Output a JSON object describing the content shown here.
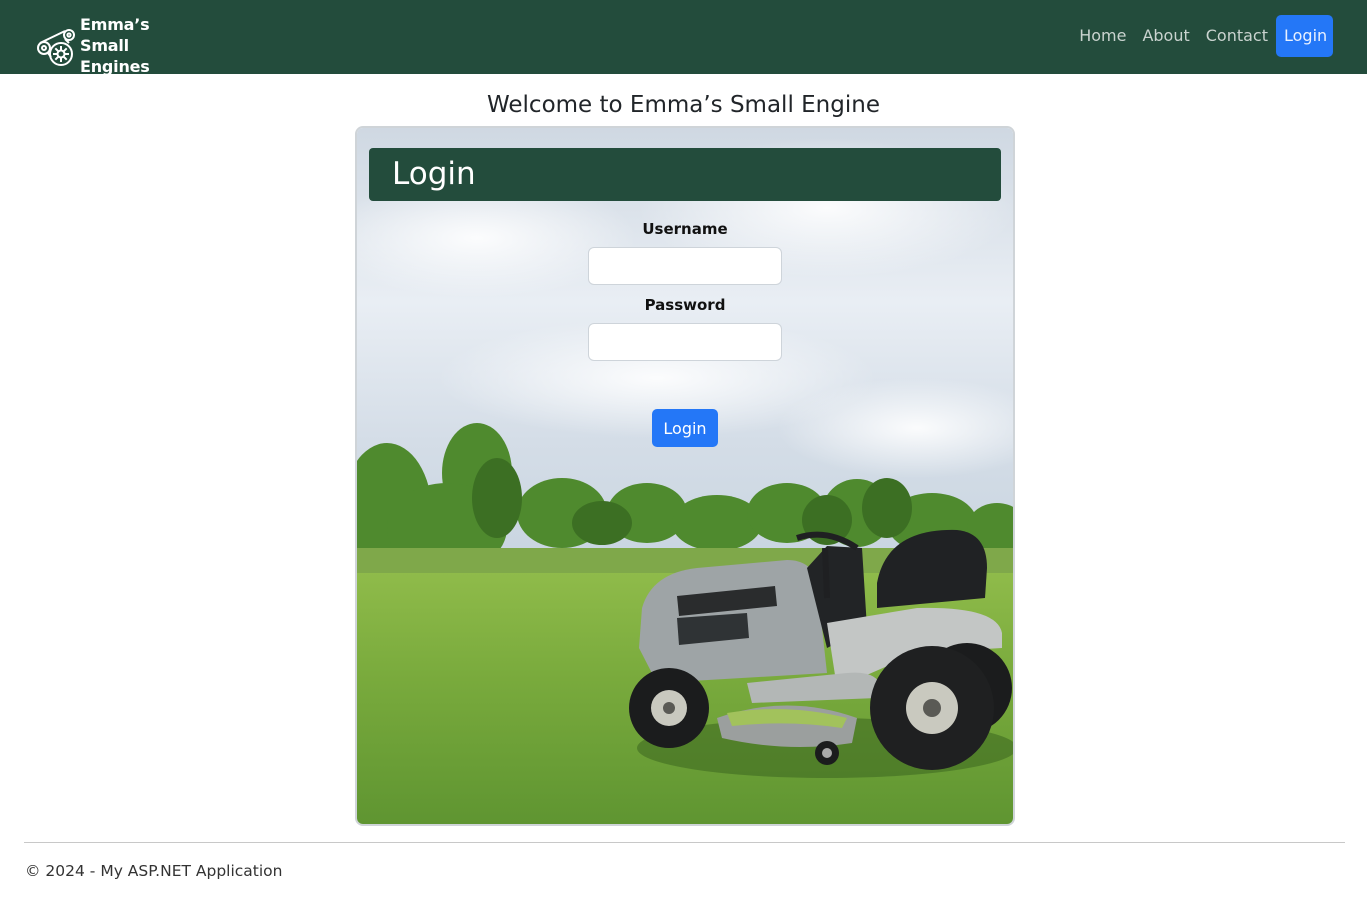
{
  "navbar": {
    "brand_line1": "Emma’s Small",
    "brand_line2": "Engines",
    "links": [
      "Home",
      "About",
      "Contact"
    ],
    "login_label": "Login",
    "background_color": "#234c3c",
    "accent_color": "#2477f7"
  },
  "page": {
    "welcome_heading": "Welcome to Emma’s Small Engine"
  },
  "login_card": {
    "header_title": "Login",
    "username_label": "Username",
    "username_value": "",
    "password_label": "Password",
    "password_value": "",
    "submit_label": "Login",
    "background_image": "riding-lawn-mower-on-grass"
  },
  "footer": {
    "text": "© 2024 - My ASP.NET Application"
  }
}
